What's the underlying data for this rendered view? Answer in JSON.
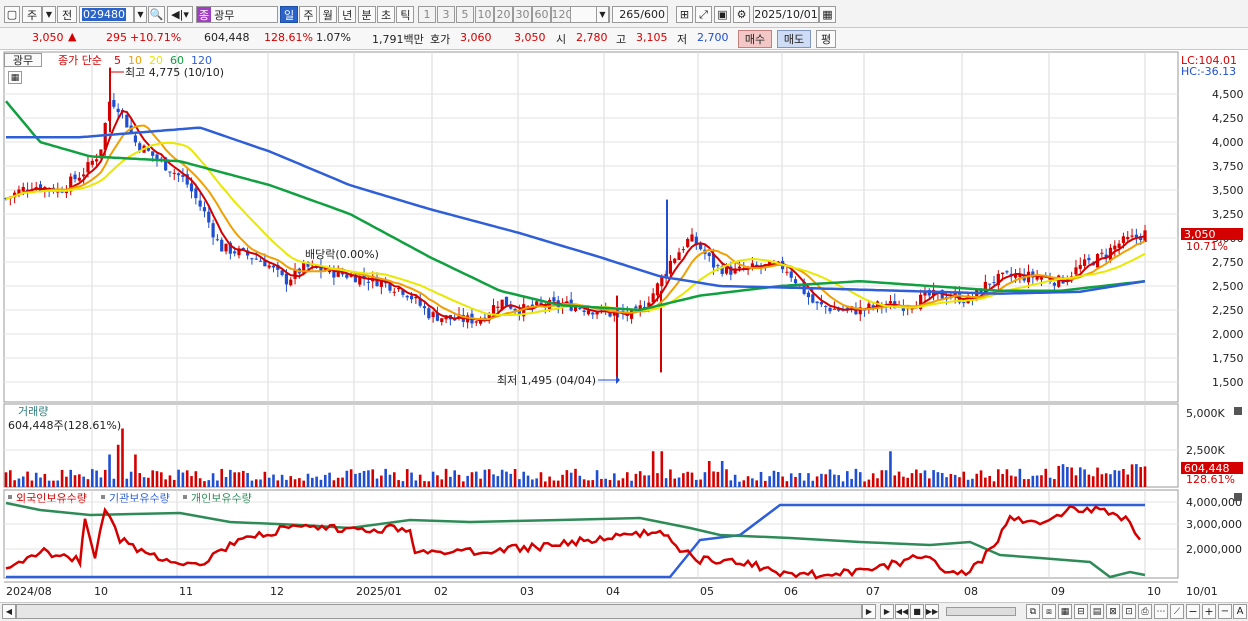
{
  "toolbar": {
    "market_type": "주",
    "category": "전",
    "code": "029480",
    "name_tag": "종",
    "stock_name": "광무",
    "period_tabs": [
      "일",
      "주",
      "월",
      "년",
      "분",
      "초",
      "틱"
    ],
    "active_period": "일",
    "interval_buttons": [
      "1",
      "3",
      "5",
      "10",
      "20",
      "30",
      "60",
      "120"
    ],
    "count": "265",
    "count_max": "/600",
    "date": "2025/10/01"
  },
  "quote": {
    "price": "3,050",
    "change_arrow": "▲",
    "change": "295",
    "change_pct": "+10.71%",
    "volume": "604,448",
    "vol_ratio": "128.61%",
    "turnover": "1.07%",
    "amount": "1,791백만",
    "ask_label": "호가",
    "ask": "3,060",
    "bid": "3,050",
    "open_label": "시",
    "open": "2,780",
    "high_label": "고",
    "high": "3,105",
    "low_label": "저",
    "low": "2,700",
    "buy": "매수",
    "sell": "매도",
    "eval": "평"
  },
  "price_panel": {
    "legend_name": "광무",
    "legend_label": "종가 단순",
    "ma_labels": [
      "5",
      "10",
      "20",
      "60",
      "120"
    ],
    "ma_colors": [
      "#d40000",
      "#f0a000",
      "#e8e800",
      "#10a040",
      "#2f5fd8"
    ],
    "lc": "LC:104.01",
    "hc": "HC:-36.13",
    "y_ticks": [
      "4,500",
      "4,250",
      "4,000",
      "3,750",
      "3,500",
      "3,250",
      "3,000",
      "2,750",
      "2,500",
      "2,250",
      "2,000",
      "1,750",
      "1,500"
    ],
    "max_note": "최고 4,775 (10/10)",
    "min_note": "최저 1,495 (04/04)",
    "div_note": "배당락(0.00%)",
    "last_price": "3,050",
    "last_pct": "10.71%"
  },
  "volume_panel": {
    "title": "거래량",
    "info": "604,448주(128.61%)",
    "y_ticks": [
      "5,000K",
      "2,500K"
    ],
    "last": "604,448",
    "last_pct": "128.61%"
  },
  "holding_panel": {
    "legends": [
      "외국인보유수량",
      "기관보유수량",
      "개인보유수량"
    ],
    "legend_colors": [
      "#d40000",
      "#2f5fd8",
      "#2e8b57"
    ],
    "y_ticks": [
      "4,000,000",
      "3,000,000",
      "2,000,000"
    ]
  },
  "x_axis": {
    "labels": [
      "2024/08",
      "10",
      "11",
      "12",
      "2025/01",
      "02",
      "03",
      "04",
      "05",
      "06",
      "07",
      "08",
      "09",
      "10"
    ],
    "right_label": "10/01"
  },
  "chart_data": {
    "type": "candlestick",
    "ylim": [
      1400,
      4800
    ],
    "x": [
      "2024/08",
      "10",
      "11",
      "12",
      "2025/01",
      "02",
      "03",
      "04",
      "05",
      "06",
      "07",
      "08",
      "09",
      "10"
    ],
    "close_approx": [
      3450,
      4100,
      3700,
      2950,
      2700,
      2150,
      2300,
      2150,
      3000,
      2700,
      2300,
      2400,
      2650,
      3050
    ],
    "high_max": 4775,
    "low_min": 1495
  }
}
